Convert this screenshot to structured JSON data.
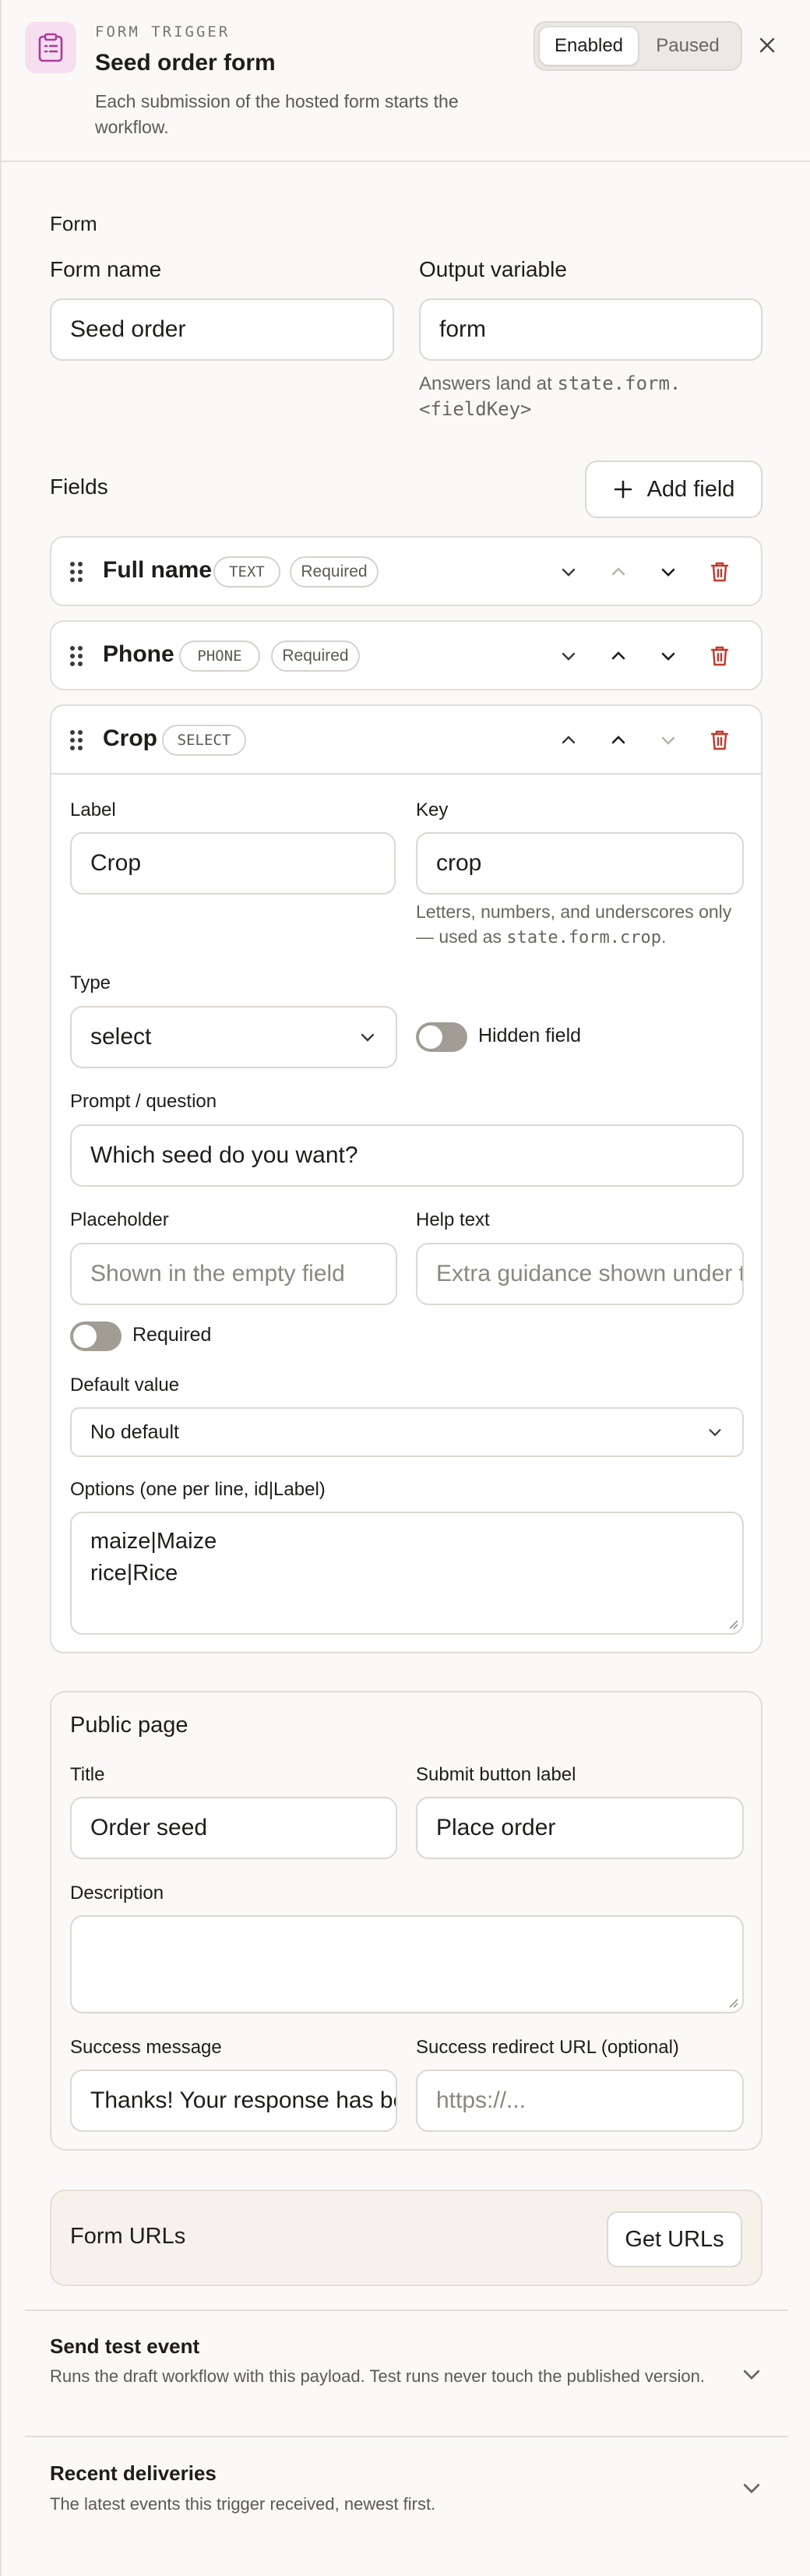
{
  "header": {
    "eyebrow": "FORM TRIGGER",
    "title": "Seed order form",
    "subtitle": "Each submission of the hosted form starts the workflow.",
    "status_options": [
      "Enabled",
      "Paused"
    ],
    "status_selected": "Enabled"
  },
  "form": {
    "section_label": "Form",
    "form_name_label": "Form name",
    "form_name_value": "Seed order",
    "output_variable_label": "Output variable",
    "output_variable_value": "form",
    "output_hint_prefix": "Answers land at",
    "output_hint_code": "state.form.<fieldKey>"
  },
  "fields": {
    "label": "Fields",
    "add_label": "Add field",
    "items": [
      {
        "name": "Full name",
        "type": "TEXT",
        "required": "Required"
      },
      {
        "name": "Phone",
        "type": "PHONE",
        "required": "Required"
      },
      {
        "name": "Crop",
        "type": "SELECT",
        "required": ""
      }
    ]
  },
  "editor": {
    "label_label": "Label",
    "label_value": "Crop",
    "key_label": "Key",
    "key_value": "crop",
    "key_hint_prefix": "Letters, numbers, and underscores only — used as",
    "key_hint_code": "state.form.crop",
    "key_hint_suffix": ".",
    "type_label": "Type",
    "type_value": "select",
    "hidden_label": "Hidden field",
    "prompt_label": "Prompt / question",
    "prompt_value": "Which seed do you want?",
    "placeholder_label": "Placeholder",
    "placeholder_placeholder": "Shown in the empty field",
    "help_label": "Help text",
    "help_placeholder": "Extra guidance shown under the field",
    "required_label": "Required",
    "default_label": "Default value",
    "default_value": "No default",
    "options_label": "Options (one per line, id|Label)",
    "options_lines": [
      "maize|Maize",
      "rice|Rice"
    ]
  },
  "public_page": {
    "label": "Public page",
    "title_label": "Title",
    "title_value": "Order seed",
    "submit_label": "Submit button label",
    "submit_value": "Place order",
    "description_label": "Description",
    "success_label": "Success message",
    "success_value": "Thanks! Your response has been recorded.",
    "redirect_label": "Success redirect URL (optional)",
    "redirect_placeholder": "https://..."
  },
  "urls": {
    "label": "Form URLs",
    "button": "Get URLs"
  },
  "accordions": [
    {
      "title": "Send test event",
      "desc": "Runs the draft workflow with this payload. Test runs never touch the published version."
    },
    {
      "title": "Recent deliveries",
      "desc": "The latest events this trigger received, newest first."
    }
  ],
  "colors": {
    "accent_icon_bg": "#f6dff0",
    "accent_icon": "#b0399a",
    "delete_red": "#c0392b"
  }
}
